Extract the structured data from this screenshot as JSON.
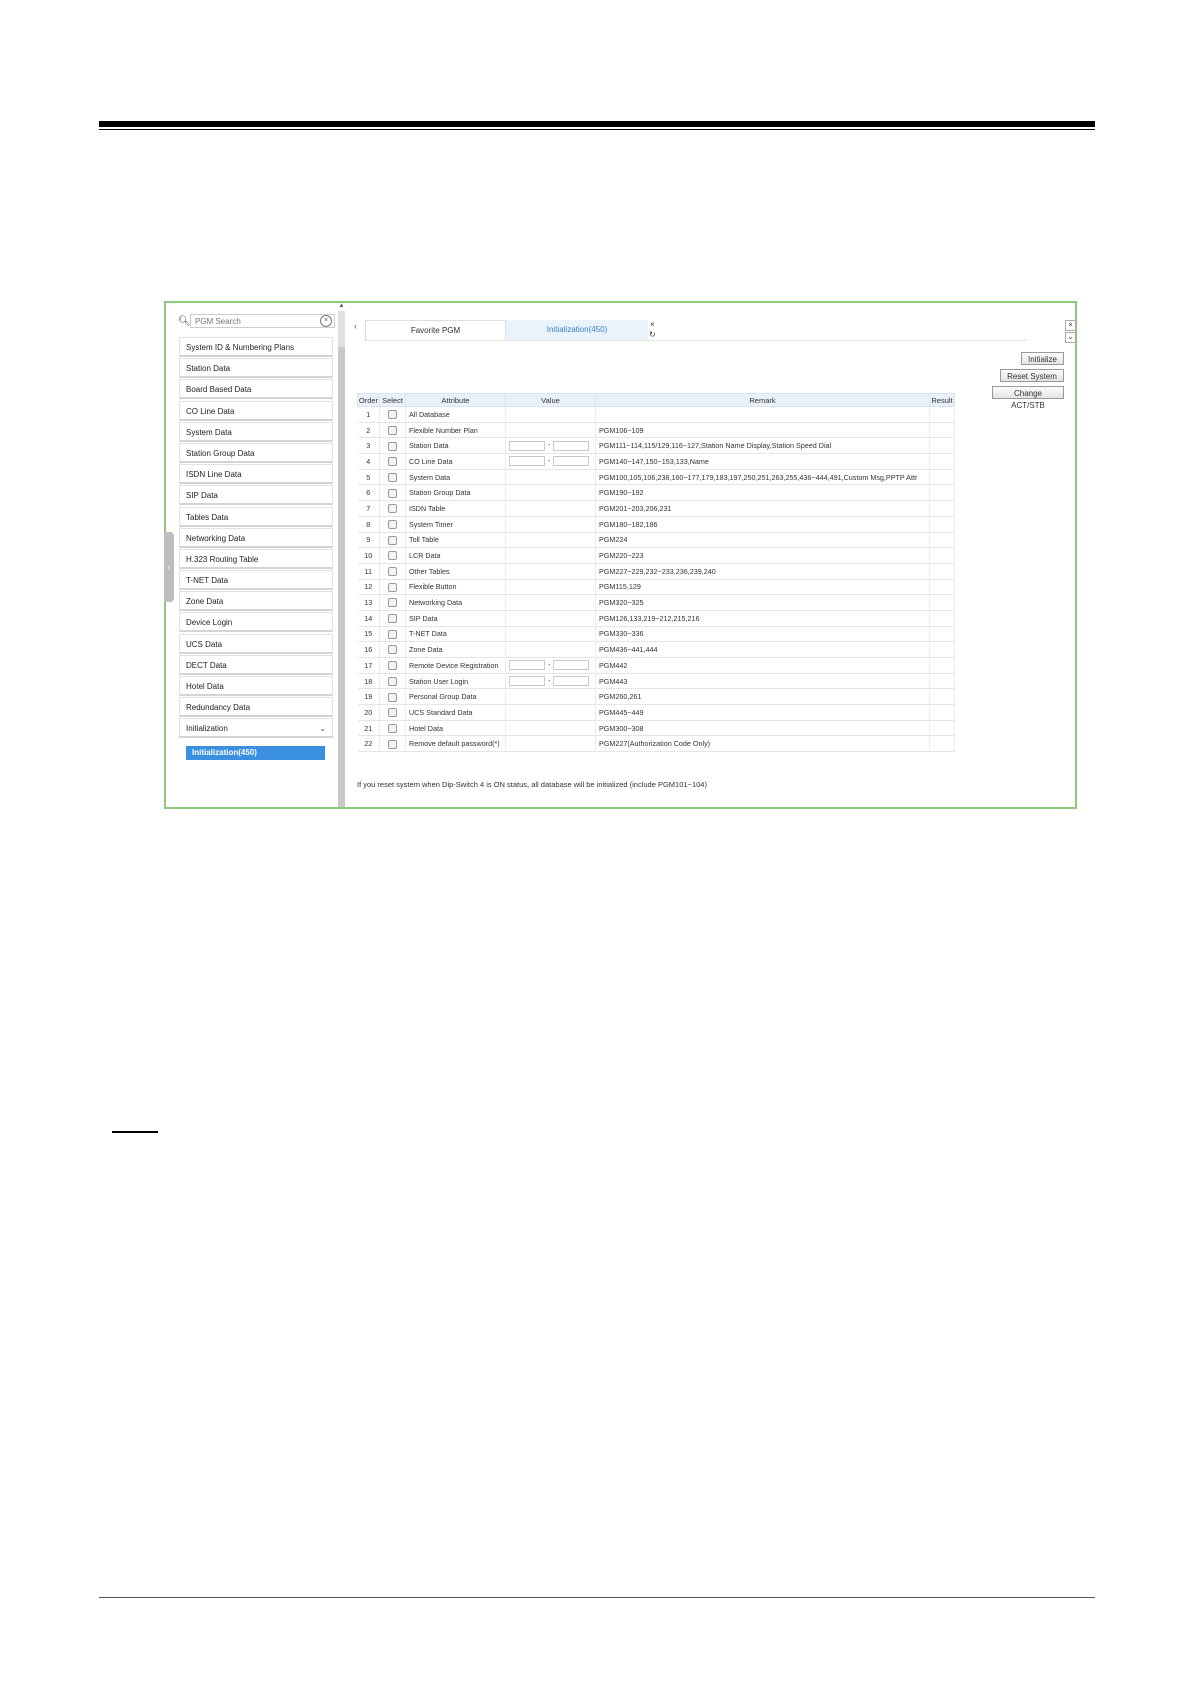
{
  "search": {
    "placeholder": "PGM Search"
  },
  "sidebar": {
    "items": [
      "System ID & Numbering Plans",
      "Station Data",
      "Board Based Data",
      "CO Line Data",
      "System Data",
      "Station Group Data",
      "ISDN Line Data",
      "SIP Data",
      "Tables Data",
      "Networking Data",
      "H.323 Routing Table",
      "T-NET Data",
      "Zone Data",
      "Device Login",
      "UCS Data",
      "DECT Data",
      "Hotel Data",
      "Redundancy Data",
      "Initialization"
    ],
    "active_sub": "Initialization(450)"
  },
  "tabs": {
    "favorite": "Favorite PGM",
    "active": "Initialization(450)"
  },
  "buttons": {
    "initialize": "Initialize",
    "reset": "Reset System",
    "change": "Change ACT/STB"
  },
  "table": {
    "headers": {
      "order": "Order",
      "select": "Select",
      "attribute": "Attribute",
      "value": "Value",
      "remark": "Remark",
      "result": "Result"
    },
    "rows": [
      {
        "order": "1",
        "attribute": "All Database",
        "remark": ""
      },
      {
        "order": "2",
        "attribute": "Flexible Number Plan",
        "remark": "PGM106~109"
      },
      {
        "order": "3",
        "attribute": "Station Data",
        "remark": "PGM111~114,115/129,116~127,Station Name Display,Station Speed Dial",
        "range": true
      },
      {
        "order": "4",
        "attribute": "CO Line Data",
        "remark": "PGM140~147,150~153,133,Name",
        "range": true
      },
      {
        "order": "5",
        "attribute": "System Data",
        "remark": "PGM100,105,106,238,160~177,179,183,197,250,251,263,255,436~444,491,Custom Msg,PPTP Attr"
      },
      {
        "order": "6",
        "attribute": "Station Group Data",
        "remark": "PGM190~192"
      },
      {
        "order": "7",
        "attribute": "ISDN Table",
        "remark": "PGM201~203,206,231"
      },
      {
        "order": "8",
        "attribute": "System Timer",
        "remark": "PGM180~182,186"
      },
      {
        "order": "9",
        "attribute": "Toll Table",
        "remark": "PGM224"
      },
      {
        "order": "10",
        "attribute": "LCR Data",
        "remark": "PGM220~223"
      },
      {
        "order": "11",
        "attribute": "Other Tables",
        "remark": "PGM227~229,232~233,236,239,240"
      },
      {
        "order": "12",
        "attribute": "Flexible Button",
        "remark": "PGM115,129"
      },
      {
        "order": "13",
        "attribute": "Networking Data",
        "remark": "PGM320~325"
      },
      {
        "order": "14",
        "attribute": "SIP Data",
        "remark": "PGM126,133,219~212,215,216"
      },
      {
        "order": "15",
        "attribute": "T-NET Data",
        "remark": "PGM330~336"
      },
      {
        "order": "16",
        "attribute": "Zone Data",
        "remark": "PGM436~441,444"
      },
      {
        "order": "17",
        "attribute": "Remote Device Registration",
        "remark": "PGM442",
        "range": true
      },
      {
        "order": "18",
        "attribute": "Station User Login",
        "remark": "PGM443",
        "range": true
      },
      {
        "order": "19",
        "attribute": "Personal Group Data",
        "remark": "PGM260,261"
      },
      {
        "order": "20",
        "attribute": "UCS Standard Data",
        "remark": "PGM445~449"
      },
      {
        "order": "21",
        "attribute": "Hotel Data",
        "remark": "PGM300~308"
      },
      {
        "order": "22",
        "attribute": "Remove default password(*)",
        "remark": "PGM227(Authorization Code Only)"
      }
    ]
  },
  "footnote": "If you reset system when Dip-Switch 4 is ON status, all database will be initialized (include PGM101~104)",
  "colors": {
    "frame_border": "#8cc97a",
    "accent": "#3b8fe0",
    "header_bg": "#e8f1f8"
  }
}
